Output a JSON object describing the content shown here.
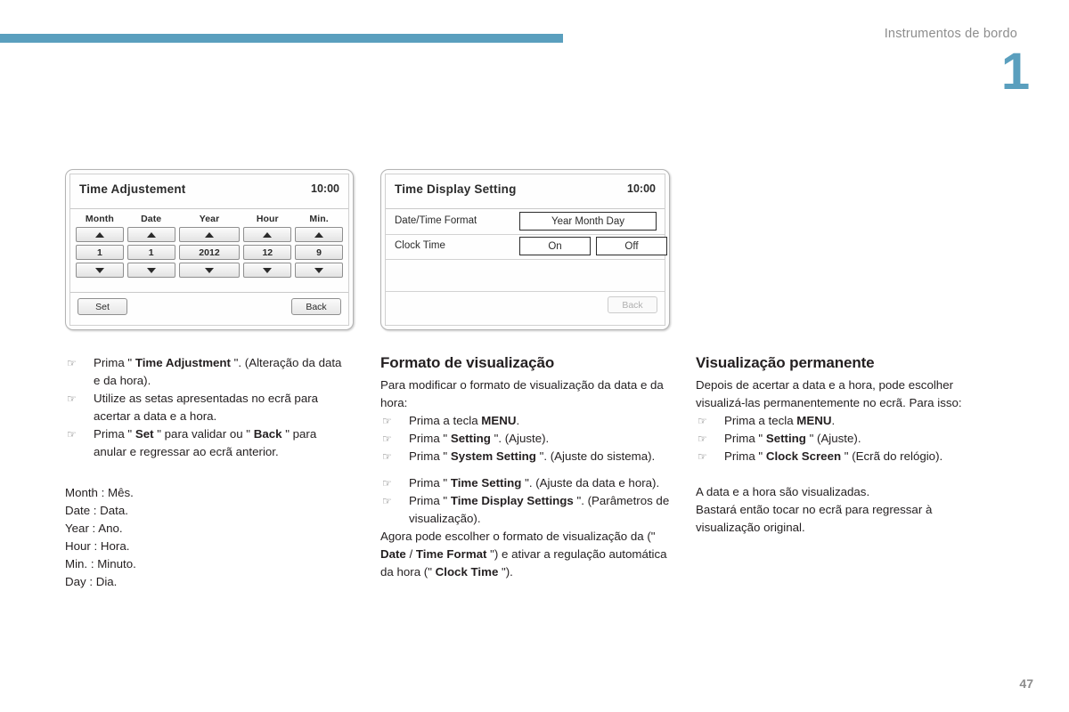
{
  "header": {
    "title": "Instrumentos de bordo",
    "chapter_number": "1",
    "rule_color": "#5a9fbe"
  },
  "page": {
    "number": "47"
  },
  "screens": [
    {
      "id": "time-adjustement",
      "title": "Time Adjustement",
      "clock": "10:00",
      "columns": [
        {
          "label": "Month",
          "up": "▲",
          "value": "1",
          "down": "▼"
        },
        {
          "label": "Date",
          "up": "▲",
          "value": "1",
          "down": "▼"
        },
        {
          "label": "Year",
          "up": "▲",
          "value": "2012",
          "down": "▼"
        },
        {
          "label": "Hour",
          "up": "▲",
          "value": "12",
          "down": "▼"
        },
        {
          "label": "Min.",
          "up": "▲",
          "value": "9",
          "down": "▼"
        }
      ],
      "set_label": "Set",
      "back_label": "Back"
    },
    {
      "id": "time-display-setting",
      "title": "Time Display Setting",
      "clock": "10:00",
      "rows": [
        {
          "label": "Date/Time Format",
          "value": "Year Month Day"
        },
        {
          "label": "Clock Time",
          "on": "On",
          "off": "Off"
        }
      ],
      "back_label": "Back"
    }
  ],
  "columns": {
    "left": {
      "bullets": [
        {
          "hand": "☞",
          "html": "Prima \" <b>Time Adjustment</b> \". (Alteração da data e da hora)."
        },
        {
          "hand": "☞",
          "html": "Utilize as setas apresentadas no ecrã para acertar a data e a hora."
        },
        {
          "hand": "☞",
          "html": "Prima \" <b>Set</b> \" para validar ou \" <b>Back</b> \" para anular e regressar ao ecrã anterior."
        }
      ],
      "glossary": [
        "Month : Mês.",
        "Date : Data.",
        "Year : Ano.",
        "Hour : Hora.",
        "Min. : Minuto.",
        "Day : Dia."
      ]
    },
    "middle": {
      "heading": "Formato de visualização",
      "intro": "Para modificar o formato de visualização da data e da hora:",
      "bullets_top": [
        {
          "hand": "☞",
          "html": "Prima a tecla <b>MENU</b>."
        },
        {
          "hand": "☞",
          "html": "Prima \" <b>Setting</b> \". (Ajuste)."
        },
        {
          "hand": "☞",
          "html": "Prima \" <b>System Setting</b> \". (Ajuste do sistema)."
        }
      ],
      "bullets_bottom": [
        {
          "hand": "☞",
          "html": "Prima \" <b>Time Setting</b> \". (Ajuste da data e hora)."
        },
        {
          "hand": "☞",
          "html": "Prima \" <b>Time Display Settings</b> \". (Parâmetros de visualização)."
        }
      ],
      "outro": "Agora pode escolher o formato de visualização da (\" <b>Date</b> / <b>Time Format</b> \") e ativar a regulação automática da hora (\" <b>Clock Time</b> \")."
    },
    "right": {
      "heading": "Visualização permanente",
      "intro": "Depois de acertar a data e a hora, pode escolher visualizá-las permanentemente no ecrã. Para isso:",
      "bullets": [
        {
          "hand": "☞",
          "html": "Prima a tecla <b>MENU</b>."
        },
        {
          "hand": "☞",
          "html": "Prima \" <b>Setting</b> \" (Ajuste)."
        },
        {
          "hand": "☞",
          "html": "Prima \" <b>Clock Screen</b> \" (Ecrã do relógio)."
        }
      ],
      "outro": "A data e a hora são visualizadas.\nBastará então tocar no ecrã para regressar à visualização original."
    }
  }
}
